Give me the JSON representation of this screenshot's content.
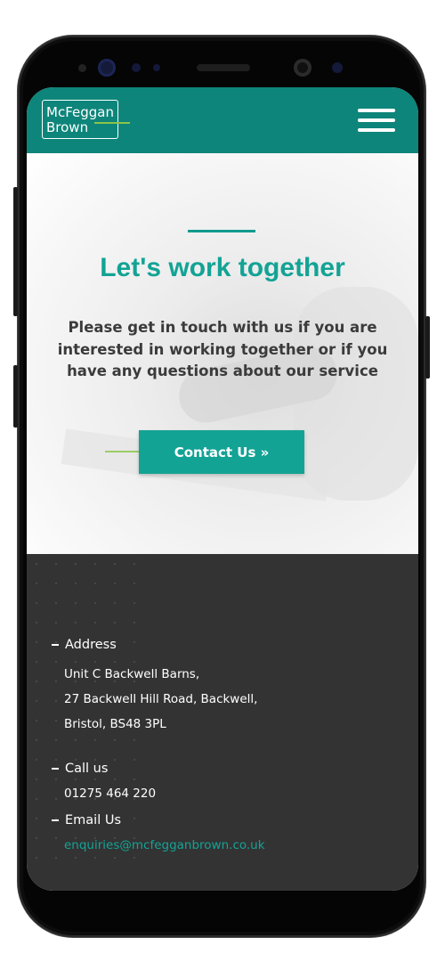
{
  "brand": {
    "logo_line1": "McFeggan",
    "logo_line2": "Brown",
    "primary_color": "#0e857a",
    "accent_color": "#13a395",
    "highlight_color": "#8bc34a"
  },
  "header": {
    "menu_icon": "hamburger-menu-icon"
  },
  "hero": {
    "title": "Let's work together",
    "description": "Please get in touch with us if you are interested in working together or if you have any questions about our service",
    "cta_label": "Contact Us »"
  },
  "footer": {
    "address_heading": "Address",
    "address_line1": "Unit C Backwell Barns,",
    "address_line2": "27 Backwell Hill Road, Backwell,",
    "address_line3": "Bristol, BS48 3PL",
    "call_heading": "Call us",
    "phone": "01275 464 220",
    "email_heading": "Email Us",
    "email": "enquiries@mcfegganbrown.co.uk"
  }
}
